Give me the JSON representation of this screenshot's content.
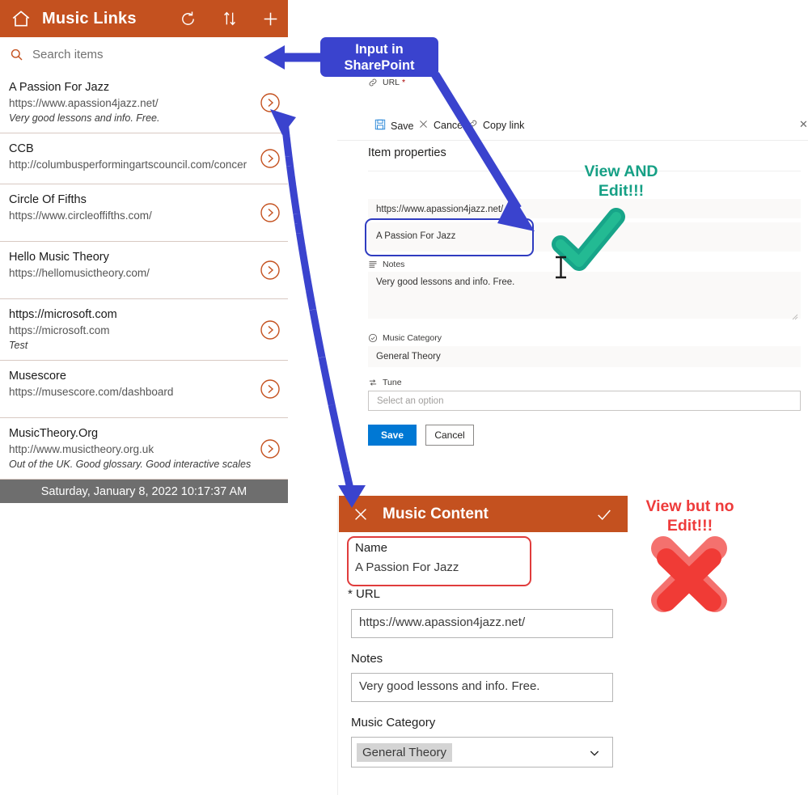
{
  "app": {
    "title": "Music Links",
    "header_icons": [
      {
        "name": "home-icon"
      },
      {
        "name": "refresh-icon"
      },
      {
        "name": "sort-icon"
      },
      {
        "name": "add-icon"
      }
    ],
    "accent_color": "#C4511F",
    "search": {
      "placeholder": "Search items",
      "value": ""
    },
    "items": [
      {
        "title": "A Passion For Jazz",
        "url": "https://www.apassion4jazz.net/",
        "note": "Very good lessons and info. Free."
      },
      {
        "title": "CCB",
        "url": "http://columbusperformingartscouncil.com/concer",
        "note": ""
      },
      {
        "title": "Circle Of Fifths",
        "url": "https://www.circleoffifths.com/",
        "note": ""
      },
      {
        "title": "Hello Music Theory",
        "url": "https://hellomusictheory.com/",
        "note": ""
      },
      {
        "title": "https://microsoft.com",
        "url": "https://microsoft.com",
        "note": "Test"
      },
      {
        "title": "Musescore",
        "url": "https://musescore.com/dashboard",
        "note": ""
      },
      {
        "title": "MusicTheory.Org",
        "url": "http://www.musictheory.org.uk",
        "note": "Out of the UK. Good glossary. Good interactive scales and"
      }
    ],
    "date_bar": "Saturday, January 8, 2022 10:17:37 AM"
  },
  "sharepoint": {
    "commands": {
      "save": "Save",
      "cancel": "Cancel",
      "copy_link": "Copy link",
      "close": "✕"
    },
    "section_title": "Item properties",
    "fields": {
      "url": {
        "label": "URL",
        "required_marker": "*",
        "value": "https://www.apassion4jazz.net/"
      },
      "title": {
        "label": "",
        "value": "A Passion For Jazz"
      },
      "notes": {
        "label": "Notes",
        "value": "Very good lessons and info. Free."
      },
      "music_category": {
        "label": "Music Category",
        "value": "General Theory"
      },
      "tune": {
        "label": "Tune",
        "placeholder": "Select an option",
        "value": ""
      }
    },
    "buttons": {
      "save": "Save",
      "cancel": "Cancel"
    }
  },
  "music_content": {
    "title": "Music Content",
    "close_icon": "close-icon",
    "confirm_icon": "check-icon",
    "accent_color": "#C4511F",
    "fields": {
      "name": {
        "label": "Name",
        "value": "A Passion For Jazz"
      },
      "url": {
        "label": "* URL",
        "value": "https://www.apassion4jazz.net/"
      },
      "notes": {
        "label": "Notes",
        "value": "Very good lessons and info. Free."
      },
      "music_category": {
        "label": "Music Category",
        "value": "General Theory"
      }
    }
  },
  "annotations": {
    "callout_sharepoint": "Input in\nSharePoint",
    "view_and_edit_line1": "View AND",
    "view_and_edit_line2": "Edit!!!",
    "view_and_edit_color": "#16A085",
    "view_no_edit_line1": "View but no",
    "view_no_edit_line2": "Edit!!!",
    "view_no_edit_color": "#EE3B3B",
    "arrow_color": "#3A43CE",
    "check_mark": "green-check-icon",
    "cross_mark": "red-x-icon"
  }
}
